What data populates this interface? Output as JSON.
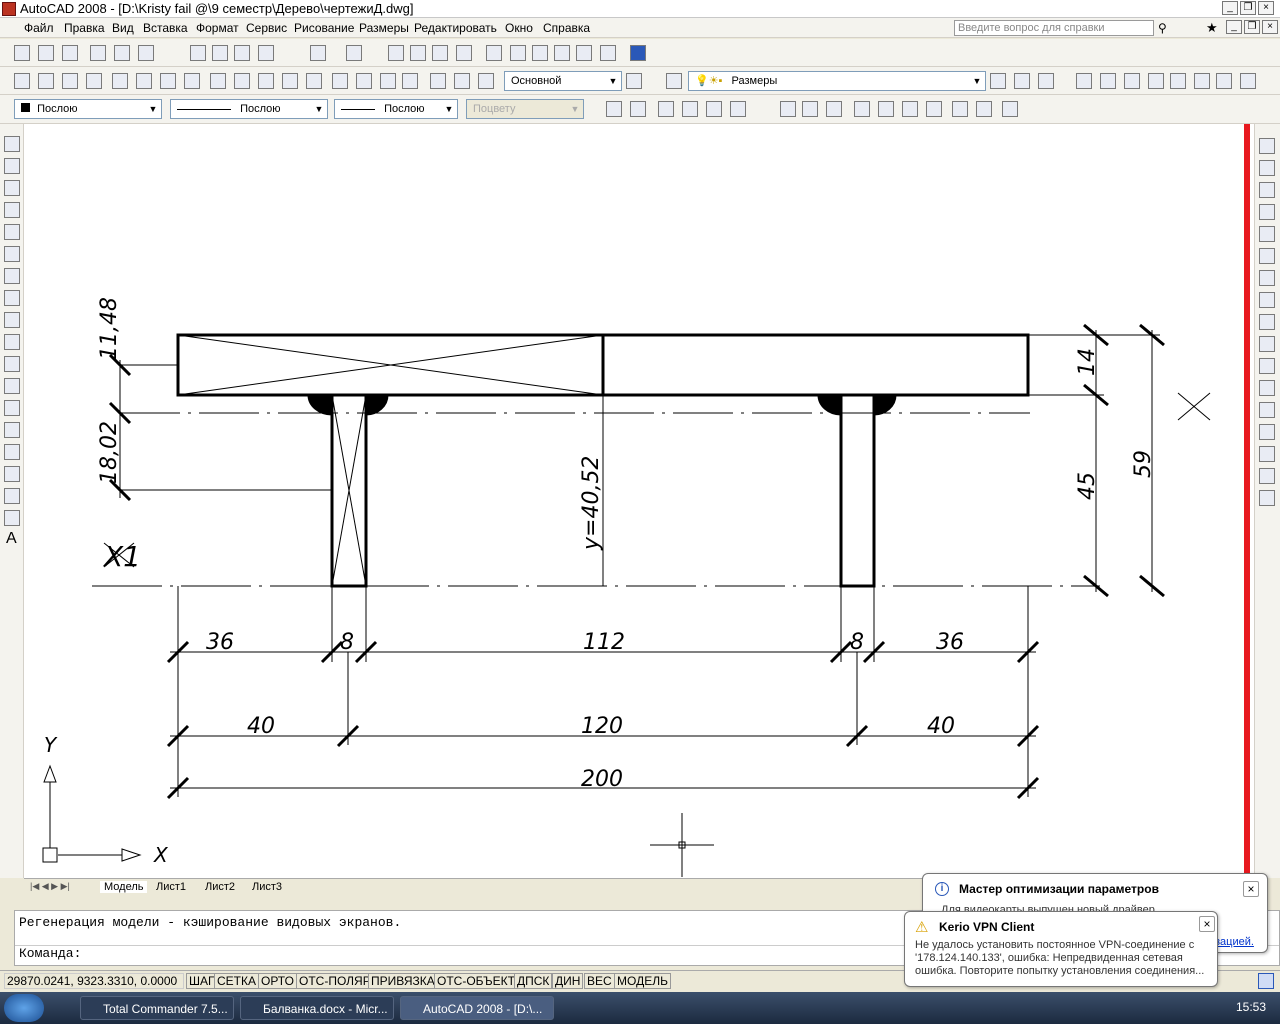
{
  "window": {
    "title": "AutoCAD 2008 - [D:\\Kristy fail @\\9 семестр\\Дерево\\чертежиД.dwg]"
  },
  "menu": [
    "Файл",
    "Правка",
    "Вид",
    "Вставка",
    "Формат",
    "Сервис",
    "Рисование",
    "Размеры",
    "Редактировать",
    "Окно",
    "Справка"
  ],
  "help_search": {
    "placeholder": "Введите вопрос для справки"
  },
  "toolbars": {
    "text_style": "Основной",
    "layer": "Размеры",
    "color": "Послою",
    "linetype": "Послою",
    "lineweight": "Послою",
    "plotstyle": "Поцвету"
  },
  "drawing": {
    "dims_row1": [
      "36",
      "8",
      "112",
      "8",
      "36"
    ],
    "dims_row2": [
      "40",
      "120",
      "40"
    ],
    "dim_total": "200",
    "dim_left_top": "11,48",
    "dim_left_mid": "18,02",
    "dim_center": "y=40,52",
    "dim_right_14": "14",
    "dim_right_45": "45",
    "dim_right_59": "59",
    "axis_label": "X1",
    "ucs_y": "Y",
    "ucs_x": "X"
  },
  "layout_tabs": [
    "Модель",
    "Лист1",
    "Лист2",
    "Лист3"
  ],
  "command": {
    "history": "Регенерация модели - кэширование видовых экранов.",
    "prompt": "Команда:"
  },
  "status": {
    "coords": "29870.0241, 9323.3310, 0.0000",
    "buttons": [
      "ШАГ",
      "СЕТКА",
      "ОРТО",
      "ОТС-ПОЛЯР",
      "ПРИВЯЗКА",
      "ОТС-ОБЪЕКТ",
      "ДПСК",
      "ДИН",
      "ВЕС",
      "МОДЕЛЬ"
    ]
  },
  "taskbar": {
    "items": [
      "Total Commander 7.5...",
      "Балванка.docx - Micr...",
      "AutoCAD 2008 - [D:\\..."
    ],
    "clock": "15:53"
  },
  "notifications": {
    "optimizer": {
      "title": "Мастер оптимизации параметров",
      "body": "Для видеокарты выпущен новый драйвер",
      "link": "зацией."
    },
    "kerio": {
      "title": "Kerio VPN Client",
      "body": "Не удалось установить постоянное VPN-соединение с '178.124.140.133', ошибка: Непредвиденная сетевая ошибка. Повторите попытку установления соединения..."
    }
  },
  "colors": {
    "accent_red": "#e8191f",
    "taskbar": "#2c3d57"
  }
}
